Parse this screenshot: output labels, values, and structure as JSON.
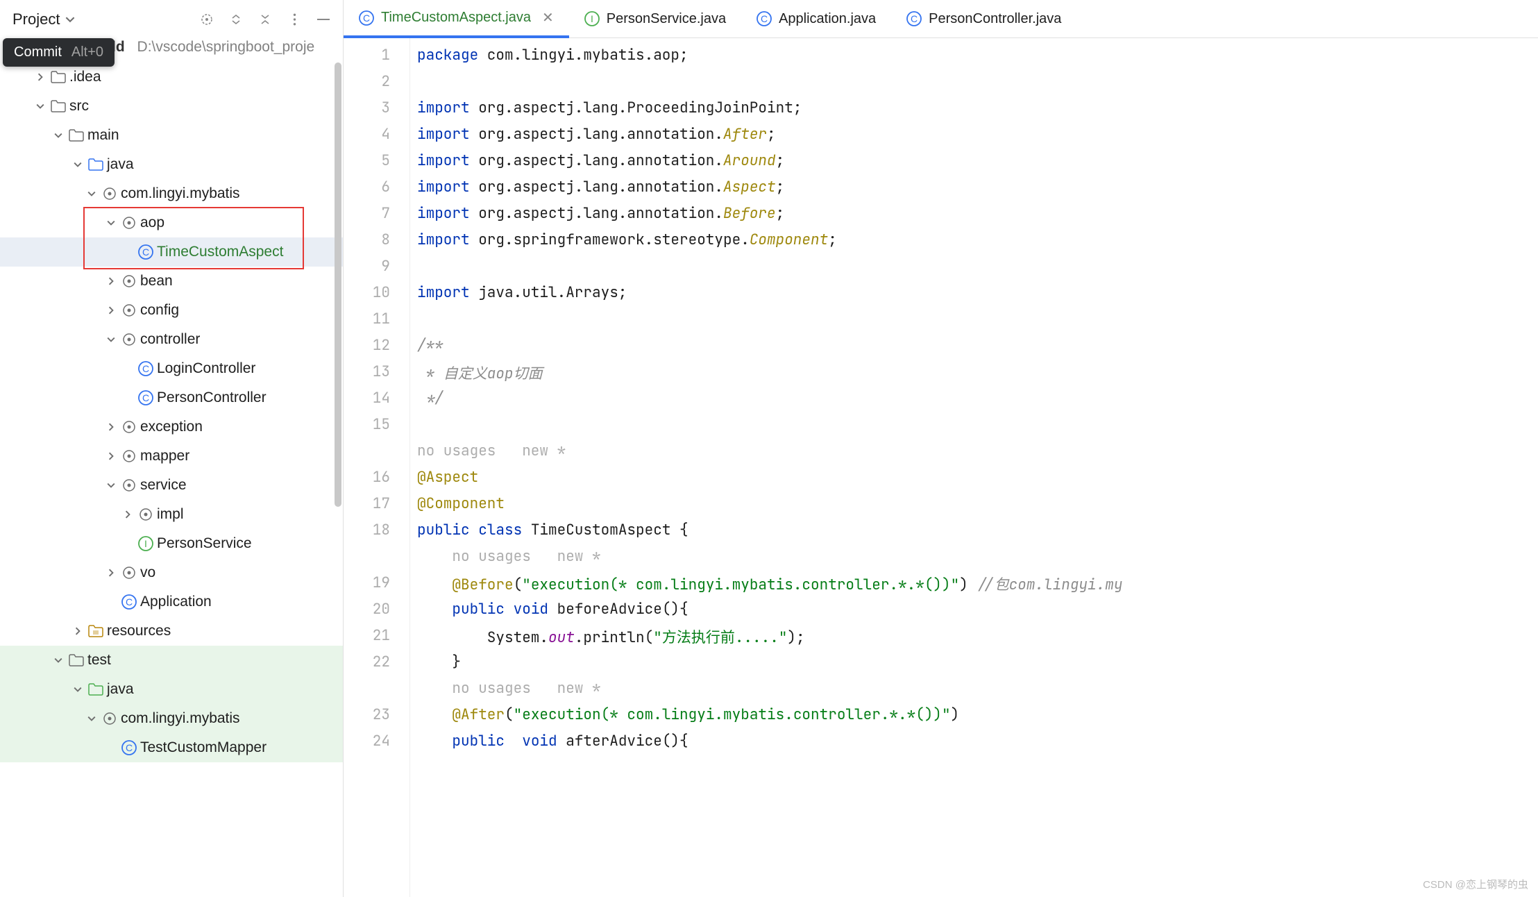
{
  "sidebar": {
    "title": "Project",
    "tooltip": {
      "label": "Commit",
      "shortcut": "Alt+0"
    },
    "breadcrumb": {
      "name": "t_helloworld",
      "path": "D:\\vscode\\springboot_proje"
    },
    "tree": [
      {
        "indent": 1,
        "arrow": "right",
        "icon": "folder",
        "label": ".idea"
      },
      {
        "indent": 1,
        "arrow": "down",
        "icon": "folder",
        "label": "src"
      },
      {
        "indent": 2,
        "arrow": "down",
        "icon": "folder",
        "label": "main"
      },
      {
        "indent": 3,
        "arrow": "down",
        "icon": "folder-blue",
        "label": "java"
      },
      {
        "indent": 4,
        "arrow": "down",
        "icon": "package",
        "label": "com.lingyi.mybatis"
      },
      {
        "indent": 5,
        "arrow": "down",
        "icon": "package",
        "label": "aop",
        "boxed": true
      },
      {
        "indent": 6,
        "arrow": "",
        "icon": "class",
        "label": "TimeCustomAspect",
        "selected": true,
        "green": true,
        "boxed": true
      },
      {
        "indent": 5,
        "arrow": "right",
        "icon": "package",
        "label": "bean"
      },
      {
        "indent": 5,
        "arrow": "right",
        "icon": "package",
        "label": "config"
      },
      {
        "indent": 5,
        "arrow": "down",
        "icon": "package",
        "label": "controller"
      },
      {
        "indent": 6,
        "arrow": "",
        "icon": "class",
        "label": "LoginController"
      },
      {
        "indent": 6,
        "arrow": "",
        "icon": "class",
        "label": "PersonController"
      },
      {
        "indent": 5,
        "arrow": "right",
        "icon": "package",
        "label": "exception"
      },
      {
        "indent": 5,
        "arrow": "right",
        "icon": "package",
        "label": "mapper"
      },
      {
        "indent": 5,
        "arrow": "down",
        "icon": "package",
        "label": "service"
      },
      {
        "indent": 6,
        "arrow": "right",
        "icon": "package",
        "label": "impl"
      },
      {
        "indent": 6,
        "arrow": "",
        "icon": "interface",
        "label": "PersonService"
      },
      {
        "indent": 5,
        "arrow": "right",
        "icon": "package",
        "label": "vo"
      },
      {
        "indent": 5,
        "arrow": "",
        "icon": "class",
        "label": "Application"
      },
      {
        "indent": 3,
        "arrow": "right",
        "icon": "resources",
        "label": "resources"
      },
      {
        "indent": 2,
        "arrow": "down",
        "icon": "folder",
        "label": "test",
        "test": true
      },
      {
        "indent": 3,
        "arrow": "down",
        "icon": "folder-green",
        "label": "java",
        "test": true
      },
      {
        "indent": 4,
        "arrow": "down",
        "icon": "package",
        "label": "com.lingyi.mybatis",
        "test": true
      },
      {
        "indent": 5,
        "arrow": "",
        "icon": "class",
        "label": "TestCustomMapper",
        "test": true
      }
    ]
  },
  "tabs": [
    {
      "icon": "class",
      "label": "TimeCustomAspect.java",
      "active": true,
      "close": true
    },
    {
      "icon": "interface",
      "label": "PersonService.java"
    },
    {
      "icon": "class",
      "label": "Application.java"
    },
    {
      "icon": "class",
      "label": "PersonController.java"
    }
  ],
  "code": {
    "lines": [
      {
        "n": 1,
        "html": "<span class='kw'>package</span> com.lingyi.mybatis.aop;"
      },
      {
        "n": 2,
        "html": ""
      },
      {
        "n": 3,
        "html": "<span class='kw'>import</span> org.aspectj.lang.ProceedingJoinPoint;"
      },
      {
        "n": 4,
        "html": "<span class='kw'>import</span> org.aspectj.lang.annotation.<span class='cls'>After</span>;"
      },
      {
        "n": 5,
        "html": "<span class='kw'>import</span> org.aspectj.lang.annotation.<span class='cls'>Around</span>;"
      },
      {
        "n": 6,
        "html": "<span class='kw'>import</span> org.aspectj.lang.annotation.<span class='cls'>Aspect</span>;"
      },
      {
        "n": 7,
        "html": "<span class='kw'>import</span> org.aspectj.lang.annotation.<span class='cls'>Before</span>;"
      },
      {
        "n": 8,
        "html": "<span class='kw'>import</span> org.springframework.stereotype.<span class='cls'>Component</span>;"
      },
      {
        "n": 9,
        "html": ""
      },
      {
        "n": 10,
        "html": "<span class='kw'>import</span> java.util.Arrays;"
      },
      {
        "n": 11,
        "html": ""
      },
      {
        "n": 12,
        "html": "<span class='comment'>/**</span>"
      },
      {
        "n": 13,
        "html": "<span class='comment'> * 自定义aop切面</span>"
      },
      {
        "n": 14,
        "html": "<span class='comment'> */</span>"
      },
      {
        "n": 15,
        "html": ""
      },
      {
        "hint": "no usages   new *"
      },
      {
        "n": 16,
        "html": "<span class='ann'>@Aspect</span>"
      },
      {
        "n": 17,
        "html": "<span class='ann'>@Component</span>"
      },
      {
        "n": 18,
        "html": "<span class='kw'>public</span> <span class='kw'>class</span> TimeCustomAspect {"
      },
      {
        "hint": "    no usages   new *"
      },
      {
        "n": 19,
        "html": "    <span class='ann'>@Before</span>(<span class='str'>\"execution(* com.lingyi.mybatis.controller.*.*())\"</span>) <span class='comment'>//包com.lingyi.my</span>"
      },
      {
        "n": 20,
        "html": "    <span class='kw'>public</span> <span class='kw'>void</span> beforeAdvice(){"
      },
      {
        "n": 21,
        "html": "        System.<span style='color:#871094;font-style:italic'>out</span>.println(<span class='str'>\"方法执行前.....\"</span>);"
      },
      {
        "n": 22,
        "html": "    }"
      },
      {
        "hint": "    no usages   new *"
      },
      {
        "n": 23,
        "html": "    <span class='ann'>@After</span>(<span class='str'>\"execution(* com.lingyi.mybatis.controller.*.*())\"</span>)"
      },
      {
        "n": 24,
        "html": "    <span class='kw'>public</span>  <span class='kw'>void</span> afterAdvice(){"
      }
    ]
  },
  "watermark": "CSDN @恋上钢琴的虫"
}
